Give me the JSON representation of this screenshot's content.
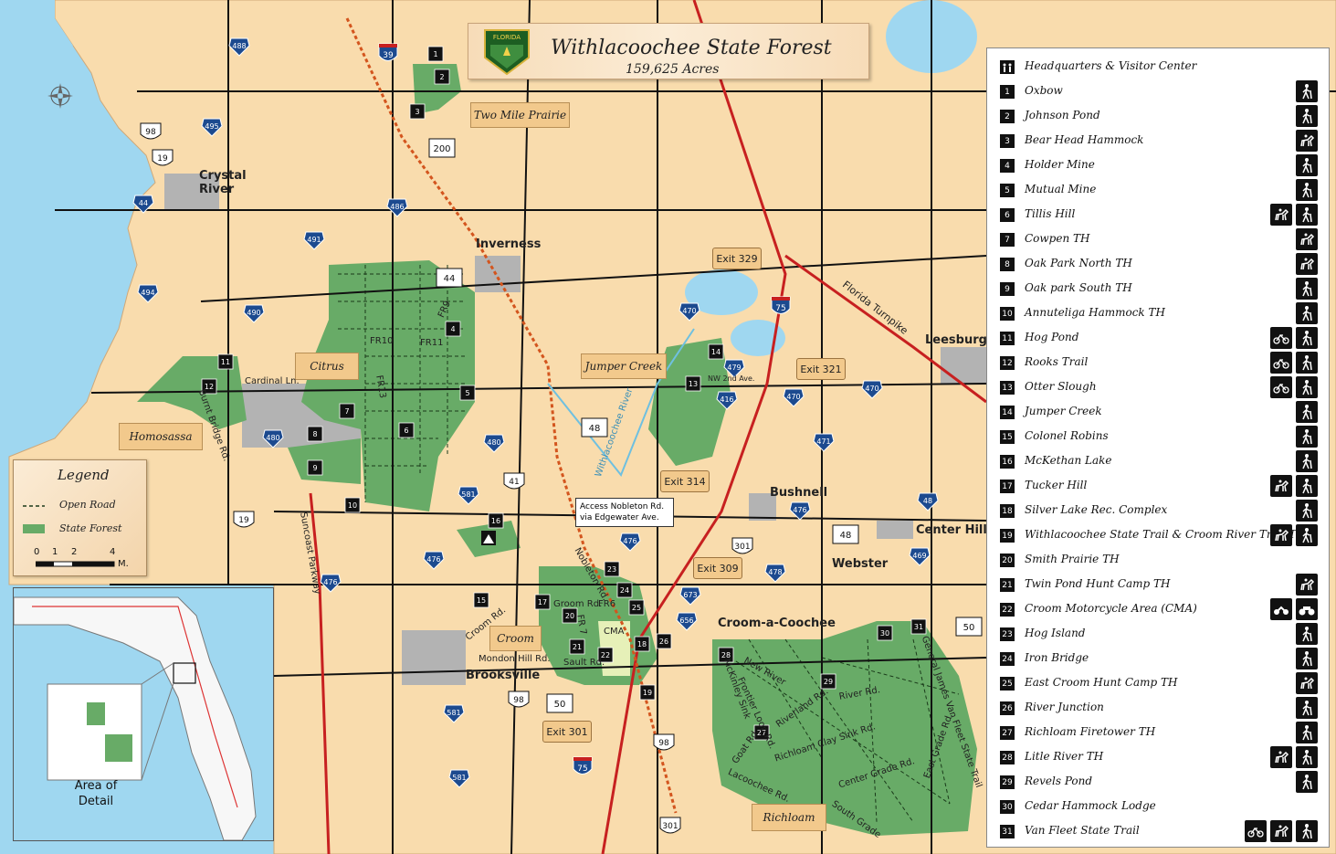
{
  "title": "Withlacoochee State Forest",
  "acres": "159,625 Acres",
  "badge_text": "FLORIDA",
  "colors": {
    "water": "#9fd7f0",
    "land": "#f9dcad",
    "forest": "#68ab67",
    "urban": "#b3b3b3",
    "label_box": "#f2c98c",
    "rail_trail": "#d3551e",
    "interstate": "#c72020"
  },
  "unit_labels": [
    {
      "id": "two-mile-prairie",
      "label": "Two Mile Prairie"
    },
    {
      "id": "citrus",
      "label": "Citrus"
    },
    {
      "id": "homosassa",
      "label": "Homosassa"
    },
    {
      "id": "jumper-creek",
      "label": "Jumper Creek"
    },
    {
      "id": "croom",
      "label": "Croom"
    },
    {
      "id": "richloam",
      "label": "Richloam"
    }
  ],
  "exits": [
    "Exit 329",
    "Exit 321",
    "Exit 314",
    "Exit 309",
    "Exit 301"
  ],
  "cities": [
    "Crystal River",
    "Inverness",
    "Leesburg",
    "Bushnell",
    "Center Hill",
    "Webster",
    "Croom-a-Coochee",
    "Brooksville"
  ],
  "road_labels": [
    "Cardinal Ln.",
    "Burnt Bridge Rd.",
    "Suncoast Parkway",
    "Florida Turnpike",
    "Withlacoochee River",
    "Nobleton Rd.",
    "Croom Rd.",
    "Groom Rd.",
    "FR6",
    "FR 7",
    "Mondon Hill Rd.",
    "Sault Rd.",
    "CMA",
    "FR10",
    "FR11",
    "FR9",
    "FR13",
    "New River",
    "McKinley Sink",
    "Frontier Loop Rd.",
    "Riverland Rd.",
    "Richloam Clay Sink Rd.",
    "Goat Rd.",
    "Lacoochee Rd.",
    "River Rd.",
    "Center Grade Rd.",
    "East Grade Rd.",
    "South Grade",
    "General James Van Fleet State Trail",
    "NW 2nd Ave."
  ],
  "callout": "Access Nobleton Rd. via Edgewater Ave.",
  "county_shields": [
    "488",
    "495",
    "44",
    "486",
    "491",
    "494",
    "490",
    "480",
    "581",
    "476",
    "480",
    "470",
    "479",
    "416",
    "470",
    "470",
    "471",
    "476",
    "478",
    "48",
    "469",
    "476",
    "476",
    "673",
    "656",
    "581",
    "581"
  ],
  "us_shields": [
    "98",
    "19",
    "41",
    "19",
    "301",
    "301",
    "98",
    "98"
  ],
  "state_shields": [
    "200",
    "44",
    "48",
    "48",
    "50",
    "50"
  ],
  "interstate_shields": [
    "39",
    "75",
    "75"
  ],
  "site_markers": [
    "1",
    "2",
    "3",
    "4",
    "5",
    "6",
    "7",
    "8",
    "9",
    "10",
    "11",
    "12",
    "13",
    "14",
    "15",
    "16",
    "17",
    "18",
    "19",
    "20",
    "21",
    "22",
    "23",
    "24",
    "25",
    "26",
    "27",
    "28",
    "29",
    "30",
    "31"
  ],
  "legend": {
    "title": "Legend",
    "open_road": "Open Road",
    "state_forest": "State Forest",
    "scale_ticks": [
      "0",
      "1",
      "2",
      "4"
    ],
    "scale_unit": "M."
  },
  "inset": {
    "label_line1": "Area of",
    "label_line2": "Detail"
  },
  "sidebar": {
    "header": "Headquarters & Visitor Center",
    "items": [
      {
        "num": "1",
        "name": "Oxbow",
        "icons": [
          "hike"
        ]
      },
      {
        "num": "2",
        "name": "Johnson Pond",
        "icons": [
          "hike"
        ]
      },
      {
        "num": "3",
        "name": "Bear Head Hammock",
        "icons": [
          "horse"
        ]
      },
      {
        "num": "4",
        "name": "Holder Mine",
        "icons": [
          "hike"
        ]
      },
      {
        "num": "5",
        "name": "Mutual Mine",
        "icons": [
          "hike"
        ]
      },
      {
        "num": "6",
        "name": "Tillis Hill",
        "icons": [
          "horse",
          "hike"
        ]
      },
      {
        "num": "7",
        "name": "Cowpen TH",
        "icons": [
          "horse"
        ]
      },
      {
        "num": "8",
        "name": "Oak Park North TH",
        "icons": [
          "horse"
        ]
      },
      {
        "num": "9",
        "name": "Oak park South TH",
        "icons": [
          "hike"
        ]
      },
      {
        "num": "10",
        "name": "Annuteliga Hammock TH",
        "icons": [
          "hike"
        ]
      },
      {
        "num": "11",
        "name": "Hog Pond",
        "icons": [
          "bike",
          "hike"
        ]
      },
      {
        "num": "12",
        "name": "Rooks Trail",
        "icons": [
          "bike",
          "hike"
        ]
      },
      {
        "num": "13",
        "name": "Otter Slough",
        "icons": [
          "bike",
          "hike"
        ]
      },
      {
        "num": "14",
        "name": "Jumper Creek",
        "icons": [
          "hike"
        ]
      },
      {
        "num": "15",
        "name": "Colonel Robins",
        "icons": [
          "hike"
        ]
      },
      {
        "num": "16",
        "name": "McKethan Lake",
        "icons": [
          "hike"
        ]
      },
      {
        "num": "17",
        "name": "Tucker Hill",
        "icons": [
          "horse",
          "hike"
        ]
      },
      {
        "num": "18",
        "name": "Silver Lake Rec. Complex",
        "icons": [
          "hike"
        ]
      },
      {
        "num": "19",
        "name": "Withlacoochee State Trail & Croom River Trail TH",
        "icons": [
          "horse",
          "hike"
        ]
      },
      {
        "num": "20",
        "name": "Smith Prairie TH",
        "icons": []
      },
      {
        "num": "21",
        "name": "Twin Pond Hunt Camp TH",
        "icons": [
          "horse"
        ]
      },
      {
        "num": "22",
        "name": "Croom Motorcycle Area (CMA)",
        "icons": [
          "moto",
          "atv"
        ]
      },
      {
        "num": "23",
        "name": "Hog Island",
        "icons": [
          "hike"
        ]
      },
      {
        "num": "24",
        "name": "Iron Bridge",
        "icons": [
          "hike"
        ]
      },
      {
        "num": "25",
        "name": "East Croom Hunt Camp TH",
        "icons": [
          "horse"
        ]
      },
      {
        "num": "26",
        "name": "River Junction",
        "icons": [
          "hike"
        ]
      },
      {
        "num": "27",
        "name": "Richloam Firetower TH",
        "icons": [
          "hike"
        ]
      },
      {
        "num": "28",
        "name": "Litle River TH",
        "icons": [
          "horse",
          "hike"
        ]
      },
      {
        "num": "29",
        "name": "Revels Pond",
        "icons": [
          "hike"
        ]
      },
      {
        "num": "30",
        "name": "Cedar Hammock Lodge",
        "icons": []
      },
      {
        "num": "31",
        "name": "Van Fleet State Trail",
        "icons": [
          "bike",
          "horse",
          "hike"
        ]
      }
    ]
  }
}
